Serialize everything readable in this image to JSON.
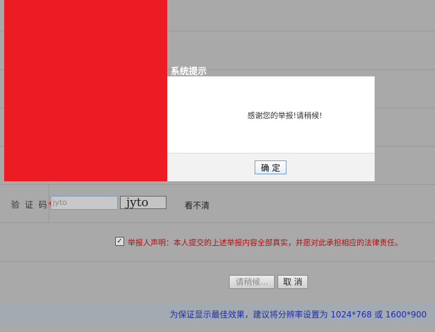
{
  "dialog": {
    "title": "系统提示",
    "message": "感谢您的举报!请稍候!",
    "ok_label": "确 定"
  },
  "form": {
    "captcha": {
      "label": "验 证 码",
      "required_mark": "*",
      "input_value": "jyto",
      "image_text": "jyto",
      "refresh_label": "看不清"
    },
    "declaration": {
      "checked": true,
      "text": "举报人声明：本人提交的上述举报内容全部真实，并愿对此承担相应的法律责任。"
    },
    "buttons": {
      "submit_label": "请稍候...",
      "cancel_label": "取 消"
    }
  },
  "footer": {
    "note": "为保证显示最佳效果，建议将分辨率设置为 1024*768 或 1600*900"
  },
  "colors": {
    "overlay_bg": "#a9a9a9",
    "red_block": "#ed1c24",
    "declaration_text": "#b01010",
    "footer_text": "#1a2db5"
  }
}
